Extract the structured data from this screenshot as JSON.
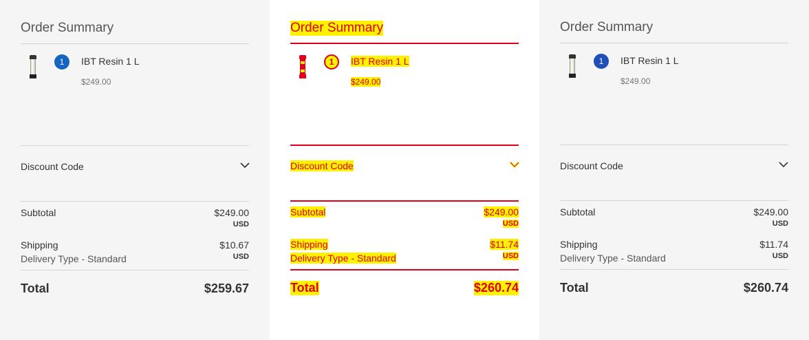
{
  "panels": [
    {
      "title": "Order Summary",
      "item": {
        "qty": "1",
        "name": "IBT Resin 1 L",
        "price": "$249.00"
      },
      "discount_label": "Discount Code",
      "subtotal_label": "Subtotal",
      "subtotal_value": "$249.00",
      "subtotal_currency": "USD",
      "shipping_label": "Shipping",
      "shipping_value": "$10.67",
      "shipping_currency": "USD",
      "delivery_type": "Delivery Type - Standard",
      "total_label": "Total",
      "total_value": "$259.67"
    },
    {
      "title": "Order Summary",
      "item": {
        "qty": "1",
        "name": "IBT Resin 1 L",
        "price": "$249.00"
      },
      "discount_label": "Discount Code",
      "subtotal_label": "Subtotal",
      "subtotal_value": "$249.00",
      "subtotal_currency": "USD",
      "shipping_label": "Shipping",
      "shipping_value": "$11.74",
      "shipping_currency": "USD",
      "delivery_type": "Delivery Type - Standard",
      "total_label": "Total",
      "total_value": "$260.74"
    },
    {
      "title": "Order Summary",
      "item": {
        "qty": "1",
        "name": "IBT Resin 1 L",
        "price": "$249.00"
      },
      "discount_label": "Discount Code",
      "subtotal_label": "Subtotal",
      "subtotal_value": "$249.00",
      "subtotal_currency": "USD",
      "shipping_label": "Shipping",
      "shipping_value": "$11.74",
      "shipping_currency": "USD",
      "delivery_type": "Delivery Type - Standard",
      "total_label": "Total",
      "total_value": "$260.74"
    }
  ],
  "colors": {
    "badge_blue": "#1565c0",
    "highlight_red": "#e0001b",
    "highlight_yellow": "#fff200",
    "panel_gray": "#f5f5f5"
  },
  "icons": {
    "product": "resin-bottle-icon",
    "discount_toggle": "chevron-down-icon"
  }
}
